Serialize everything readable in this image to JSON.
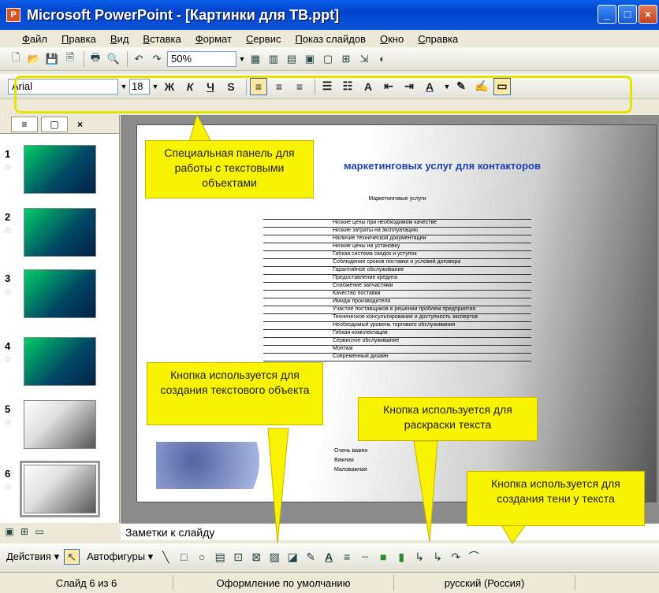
{
  "window": {
    "title": "Microsoft PowerPoint - [Картинки для ТВ.ppt]",
    "app_icon": "P",
    "buttons": [
      "_",
      "□",
      "×"
    ]
  },
  "menu": [
    "Файл",
    "Правка",
    "Вид",
    "Вставка",
    "Формат",
    "Сервис",
    "Показ слайдов",
    "Окно",
    "Справка"
  ],
  "standard_toolbar": {
    "zoom": "50%"
  },
  "formatting_toolbar": {
    "font": "Arial",
    "size": "18",
    "bold": "Ж",
    "italic": "К",
    "underline": "Ч",
    "shadow": "S",
    "font_color_icon": "A"
  },
  "slides_pane": {
    "tabs": [
      "≡",
      "▢"
    ],
    "close": "×",
    "slides": [
      {
        "num": "1",
        "star": "☆"
      },
      {
        "num": "2",
        "star": "☆"
      },
      {
        "num": "3",
        "star": "☆"
      },
      {
        "num": "4",
        "star": "☆"
      },
      {
        "num": "5",
        "star": "☆"
      },
      {
        "num": "6",
        "star": "☆"
      }
    ]
  },
  "slide": {
    "title": "маркетинговых услуг для контакторов",
    "table_header": "Маркетинговые услуги",
    "rows": [
      "Низкие цены при необходимом качестве",
      "Низкие затраты на эксплуатацию",
      "Наличие технической документации",
      "Низкие цены на установку",
      "Гибкая система скидок и уступок",
      "Соблюдение сроков поставки и условий договора",
      "Гарантийное обслуживание",
      "Предоставление кредита",
      "Снабжение запчастями",
      "Качество поставки",
      "Имидж производителя",
      "Участие поставщиков в решении проблем предприятия",
      "Техническое консультирование и доступность экспертов",
      "Необходимый уровень торгового обслуживания",
      "Гибкая комплектация",
      "Сервисное обслуживание",
      "Монтаж",
      "Современный дизайн"
    ],
    "legend": [
      "Очень важно",
      "Важная",
      "Маловажная"
    ]
  },
  "notes_placeholder": "Заметки к слайду",
  "drawing_toolbar": {
    "actions": "Действия ▾",
    "autoshapes": "Автофигуры ▾"
  },
  "status": {
    "slide": "Слайд 6 из 6",
    "design": "Оформление по умолчанию",
    "language": "русский (Россия)"
  },
  "callouts": {
    "panel": "Специальная панель для работы с текстовыми объектами",
    "textbox": "Кнопка используется для создания текстового объекта",
    "color": "Кнопка используется для раскраски текста",
    "shadow": "Кнопка используется для создания тени у текста"
  }
}
